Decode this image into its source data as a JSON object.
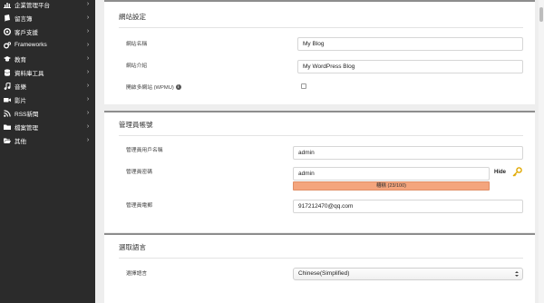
{
  "sidebar": {
    "items": [
      {
        "label": "企業管理平台",
        "icon": "bar-chart-icon"
      },
      {
        "label": "留言簿",
        "icon": "book-icon"
      },
      {
        "label": "客戶支援",
        "icon": "lifebuoy-icon"
      },
      {
        "label": "Frameworks",
        "icon": "cogs-icon"
      },
      {
        "label": "教育",
        "icon": "graduation-cap-icon"
      },
      {
        "label": "資料庫工具",
        "icon": "database-icon"
      },
      {
        "label": "音樂",
        "icon": "music-icon"
      },
      {
        "label": "影片",
        "icon": "video-camera-icon"
      },
      {
        "label": "RSS新聞",
        "icon": "rss-icon"
      },
      {
        "label": "檔案管理",
        "icon": "folder-icon"
      },
      {
        "label": "其他",
        "icon": "folder-open-icon"
      }
    ],
    "chevron": "›"
  },
  "site_settings": {
    "title": "網站設定",
    "site_name_label": "網站名稱",
    "site_name_value": "My Blog",
    "site_desc_label": "網站介紹",
    "site_desc_value": "My WordPress Blog",
    "multisite_label": "開啟多網站 (WPMU)",
    "info_icon": "i"
  },
  "admin_account": {
    "title": "管理員帳號",
    "username_label": "管理員用戶名稱",
    "username_value": "admin",
    "password_label": "管理員密碼",
    "password_value": "admin",
    "hide_label": "Hide",
    "strength_text": "糟糕 (23/100)",
    "strength_color": "#f4a57d",
    "email_label": "管理員電郵",
    "email_value": "917212470@qq.com"
  },
  "language": {
    "title": "選取語言",
    "select_label": "選擇語言",
    "selected_value": "Chinese(Simplified)"
  }
}
